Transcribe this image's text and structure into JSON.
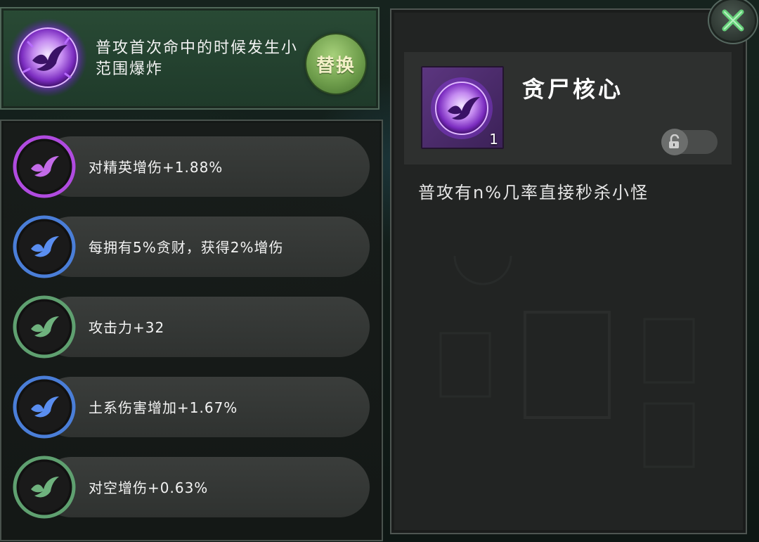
{
  "current_effect": {
    "text": "普攻首次命中的时候发生小范围爆炸",
    "replace_label": "替换",
    "icon": "purple-phoenix-orb-icon"
  },
  "stats": [
    {
      "label": "对精英增伤+1.88%",
      "tier": "purple",
      "icon": "phoenix-icon"
    },
    {
      "label": "每拥有5%贪财，获得2%增伤",
      "tier": "blue",
      "icon": "phoenix-icon"
    },
    {
      "label": "攻击力+32",
      "tier": "green",
      "icon": "phoenix-icon"
    },
    {
      "label": "土系伤害增加+1.67%",
      "tier": "blue",
      "icon": "phoenix-icon"
    },
    {
      "label": "对空增伤+0.63%",
      "tier": "green",
      "icon": "phoenix-icon"
    }
  ],
  "detail": {
    "item_name": "贪尸核心",
    "item_count": "1",
    "description": "普攻有n%几率直接秒杀小怪",
    "lock_state": "unlocked",
    "icon": "purple-phoenix-orb-icon"
  },
  "colors": {
    "purple": "#b04be0",
    "blue": "#4a7ed8",
    "green": "#5fa070",
    "replace_button": "#7fae58",
    "close_x": "#66d07a"
  },
  "close_icon": "close-x-icon"
}
